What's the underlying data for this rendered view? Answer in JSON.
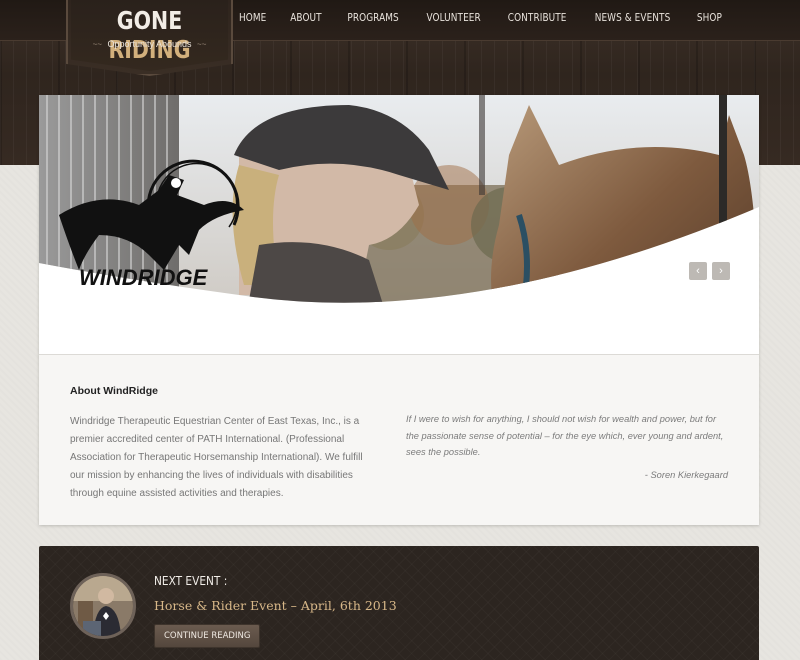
{
  "logo": {
    "title_part1": "GONE",
    "title_part2": "RIDING",
    "subtitle": "Opportunity Abounds",
    "ornament_left": "~~",
    "ornament_right": "~~"
  },
  "nav": {
    "items": [
      {
        "label": "HOME"
      },
      {
        "label": "ABOUT"
      },
      {
        "label": "PROGRAMS"
      },
      {
        "label": "VOLUNTEER"
      },
      {
        "label": "CONTRIBUTE"
      },
      {
        "label": "NEWS & EVENTS"
      },
      {
        "label": "SHOP"
      }
    ]
  },
  "slider": {
    "brand_text": "WINDRIDGE",
    "prev_icon": "‹",
    "next_icon": "›"
  },
  "about": {
    "title": "About WindRidge",
    "text": "Windridge Therapeutic Equestrian Center of East Texas, Inc., is a premier accredited center of PATH International. (Professional Association for Therapeutic Horsemanship International).  We fulfill our mission by enhancing the lives of individuals with disabilities through equine assisted activities and therapies.",
    "quote": "If I were to wish for anything, I should not wish for wealth and power, but for the passionate sense of potential – for the eye which, ever young and ardent, sees the possible.",
    "quote_author": "- Soren Kierkegaard"
  },
  "event": {
    "label": "NEXT EVENT :",
    "title": "Horse & Rider Event – April, 6th 2013",
    "button_label": "CONTINUE READING"
  }
}
